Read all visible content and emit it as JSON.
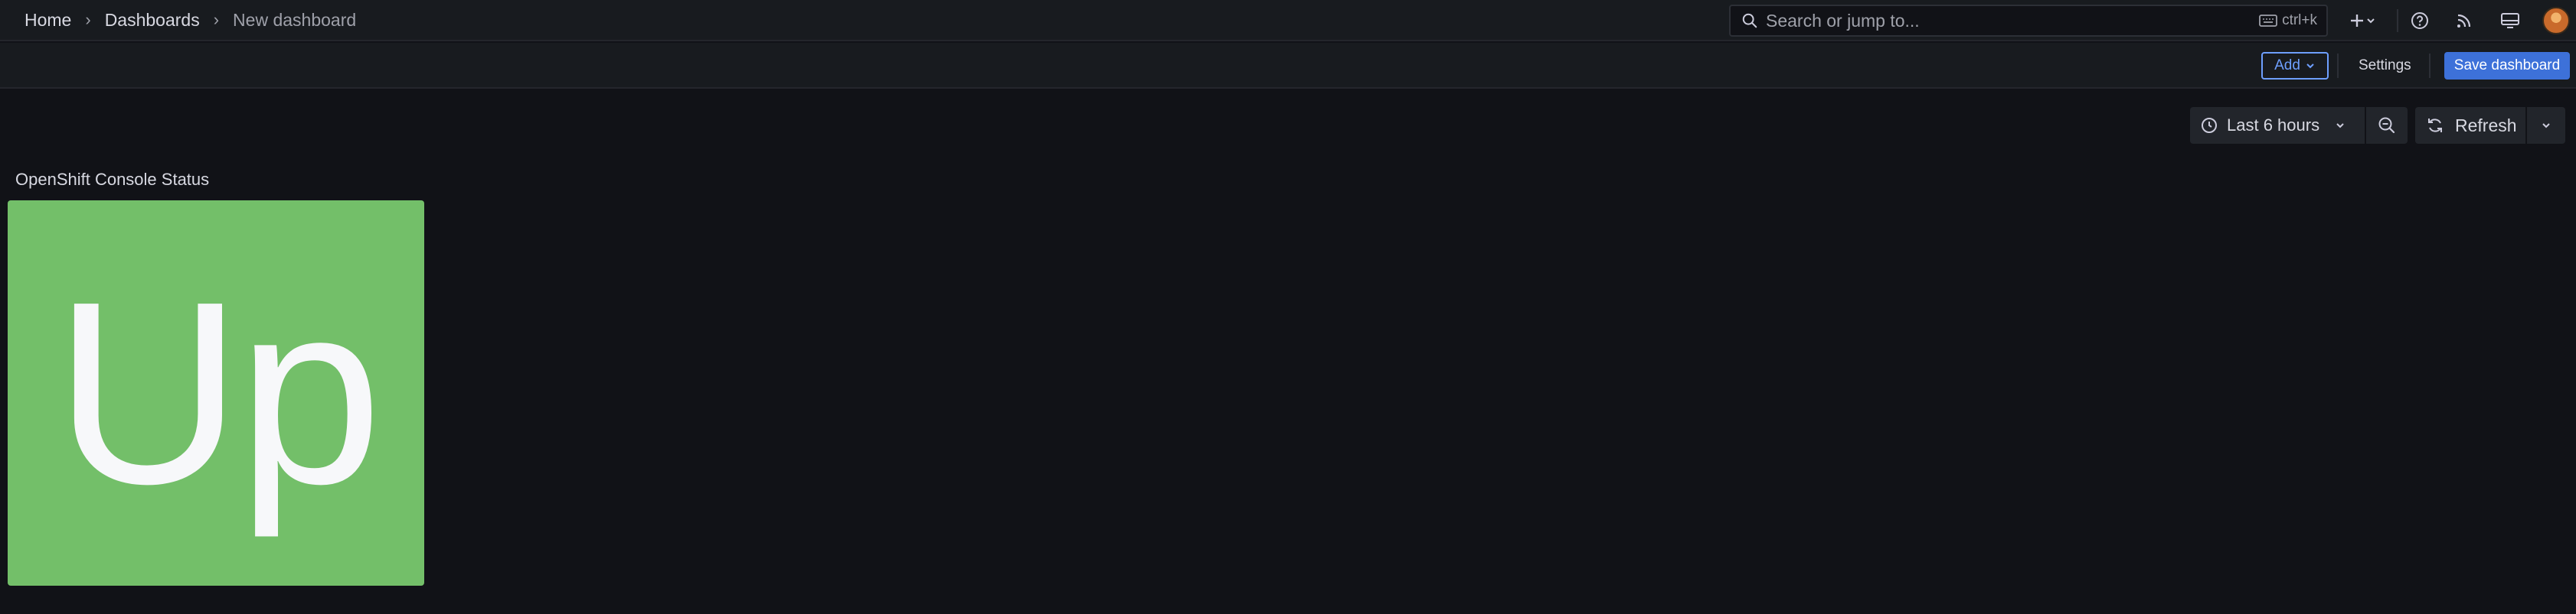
{
  "breadcrumb": {
    "home": "Home",
    "dashboards": "Dashboards",
    "current": "New dashboard"
  },
  "search": {
    "placeholder": "Search or jump to...",
    "shortcut": "ctrl+k"
  },
  "topbar": {
    "icons": [
      "plus-icon",
      "help-icon",
      "news-icon",
      "kiosk-icon"
    ]
  },
  "toolbar": {
    "add_label": "Add",
    "settings_label": "Settings",
    "save_label": "Save dashboard"
  },
  "time_picker": {
    "range_label": "Last 6 hours"
  },
  "refresh": {
    "label": "Refresh"
  },
  "panel": {
    "title": "OpenShift Console Status",
    "value": "Up",
    "background": "#73bf69"
  },
  "colors": {
    "accent": "#3d71d9",
    "link": "#6e9fff",
    "background": "#111217",
    "stat_green": "#73bf69"
  }
}
